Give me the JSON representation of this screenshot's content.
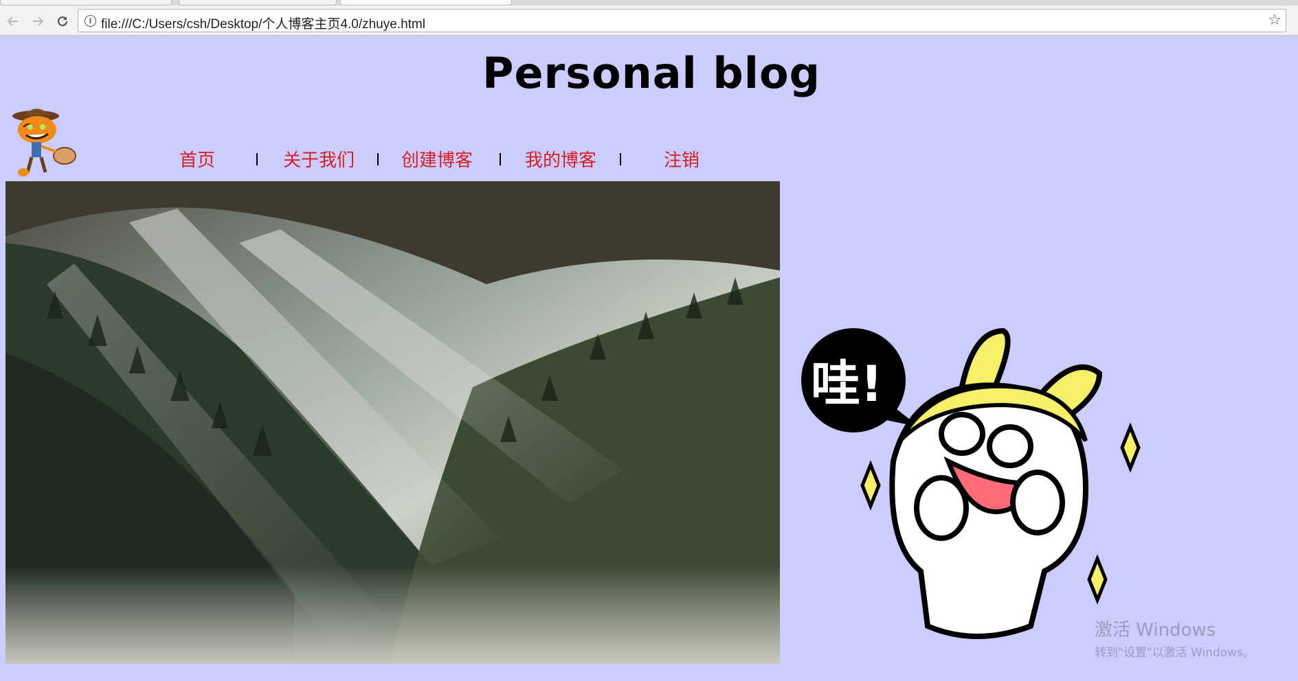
{
  "browser": {
    "url": "file:///C:/Users/csh/Desktop/个人博客主页4.0/zhuye.html",
    "back_icon": "back-arrow-icon",
    "forward_icon": "forward-arrow-icon",
    "reload_icon": "reload-icon",
    "info_icon": "info-icon",
    "bookmark_icon": "star-icon"
  },
  "page": {
    "title": "Personal blog",
    "background_color": "#ccccff",
    "nav_color": "#d41f26",
    "nav": [
      {
        "label": "首页"
      },
      {
        "label": "关于我们"
      },
      {
        "label": "创建博客"
      },
      {
        "label": "我的博客"
      },
      {
        "label": "注销"
      }
    ],
    "sticker_text": "哇!"
  },
  "os_watermark": {
    "line1": "激活 Windows",
    "line2": "转到\"设置\"以激活 Windows。"
  }
}
